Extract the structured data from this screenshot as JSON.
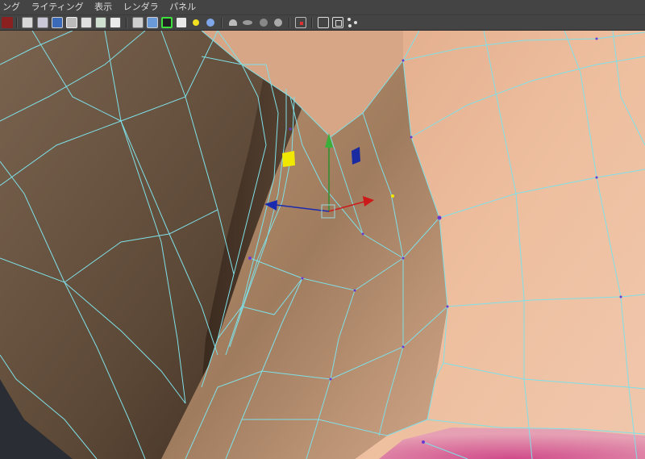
{
  "menubar": {
    "items": [
      "ング",
      "ライティング",
      "表示",
      "レンダラ",
      "パネル"
    ]
  },
  "toolbar": {
    "groups": [
      [
        "select-tool-icon"
      ],
      [
        "wireframe-icon",
        "smooth-shade-icon",
        "shaded-icon",
        "textured-icon",
        "xray-icon",
        "light-icon",
        "text-icon"
      ],
      [
        "cube-wire-icon",
        "cube-shaded-icon",
        "isolate-select-icon",
        "checker-icon",
        "default-light-icon",
        "sphere-light-icon"
      ],
      [
        "dome-icon",
        "ellipse-icon",
        "flat-shade-icon",
        "smooth-sphere-icon"
      ],
      [
        "cursor-select-icon"
      ],
      [
        "box-icon",
        "double-box-icon",
        "network-icon"
      ]
    ]
  },
  "viewport": {
    "skin_color": "#e6b596",
    "wire_color": "#7fe0e8",
    "background": "#2f3237",
    "manipulator": {
      "x_axis_color": "#cc1a1a",
      "y_axis_color": "#2f8f2f",
      "z_axis_color": "#1a2ab0",
      "plane_handle_colors": [
        "#f0e800",
        "#1a2aa0"
      ]
    }
  }
}
